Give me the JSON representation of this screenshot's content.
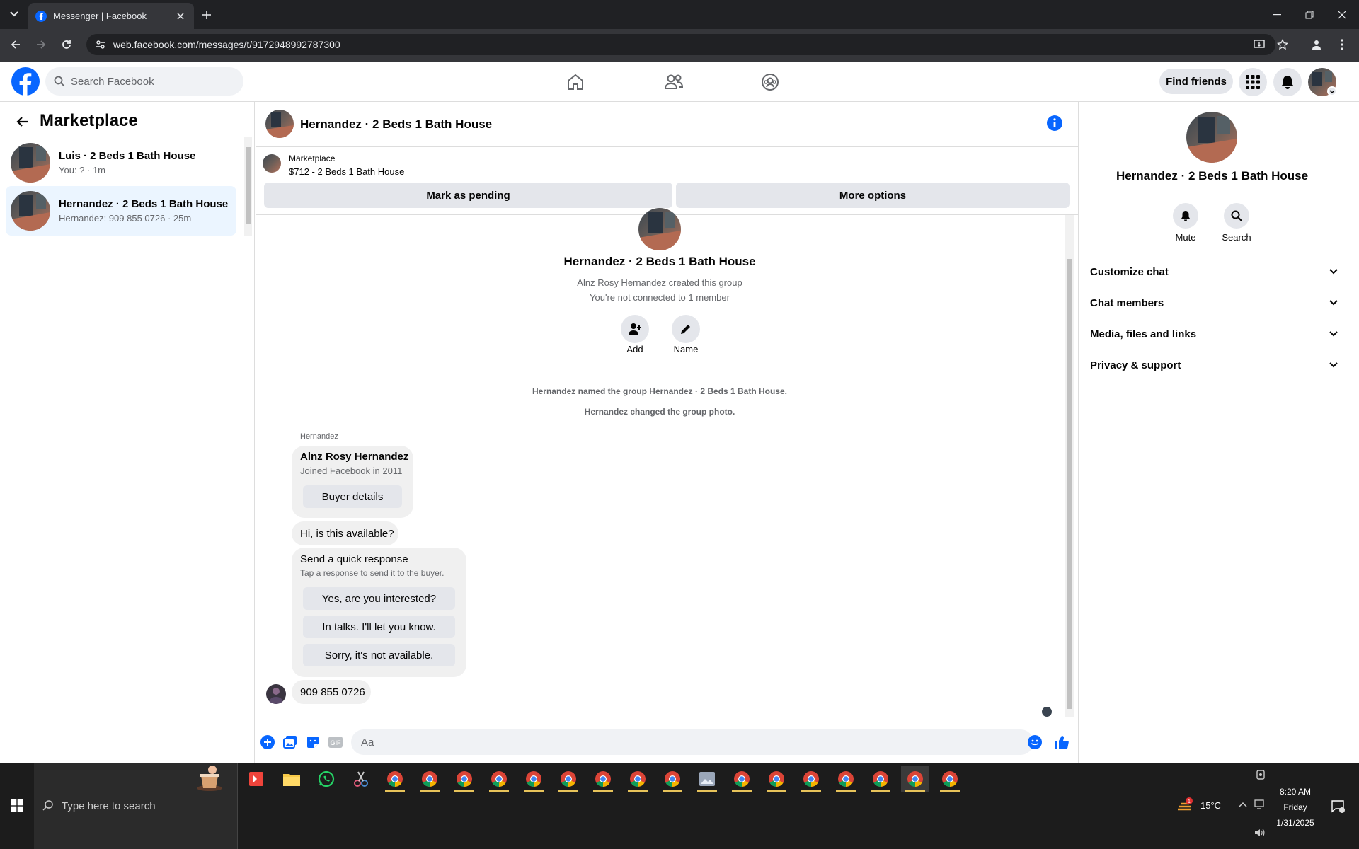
{
  "browser": {
    "tab_title": "Messenger | Facebook",
    "url": "web.facebook.com/messages/t/9172948992787300"
  },
  "header": {
    "search_placeholder": "Search Facebook",
    "find_friends": "Find friends"
  },
  "sidebar": {
    "title": "Marketplace",
    "conversations": [
      {
        "name": "Luis · 2 Beds 1 Bath House",
        "preview": "You: ? · 1m"
      },
      {
        "name": "Hernandez · 2 Beds 1 Bath House",
        "preview": "Hernandez: 909 855 0726 · 25m"
      }
    ]
  },
  "chat": {
    "title": "Hernandez · 2 Beds 1 Bath House",
    "marketplace_label": "Marketplace",
    "listing": "$712 - 2 Beds 1 Bath House",
    "mark_pending": "Mark as pending",
    "more_options": "More options",
    "group_name": "Hernandez · 2 Beds 1 Bath House",
    "created_by": "Alnz Rosy Hernandez created this group",
    "not_connected": "You're not connected to 1 member",
    "add_label": "Add",
    "name_label": "Name",
    "system_messages": [
      "Hernandez named the group Hernandez · 2 Beds 1 Bath House.",
      "Hernandez changed the group photo."
    ],
    "sender": "Hernandez",
    "buyer_card": {
      "name": "Alnz Rosy Hernandez",
      "joined": "Joined Facebook in 2011",
      "button": "Buyer details"
    },
    "message_hi": "Hi, is this available?",
    "quick_response": {
      "title": "Send a quick response",
      "subtitle": "Tap a response to send it to the buyer.",
      "options": [
        "Yes, are you interested?",
        "In talks. I'll let you know.",
        "Sorry, it's not available."
      ]
    },
    "message_phone": "909 855 0726",
    "composer_placeholder": "Aa"
  },
  "right_panel": {
    "name": "Hernandez · 2 Beds 1 Bath House",
    "mute": "Mute",
    "search": "Search",
    "sections": [
      "Customize chat",
      "Chat members",
      "Media, files and links",
      "Privacy & support"
    ]
  },
  "taskbar": {
    "search_placeholder": "Type here to search",
    "temperature": "15°C",
    "time": "8:20 AM",
    "day": "Friday",
    "date": "1/31/2025"
  },
  "colors": {
    "facebook_blue": "#0866ff",
    "active_conversation": "#ebf5ff"
  }
}
